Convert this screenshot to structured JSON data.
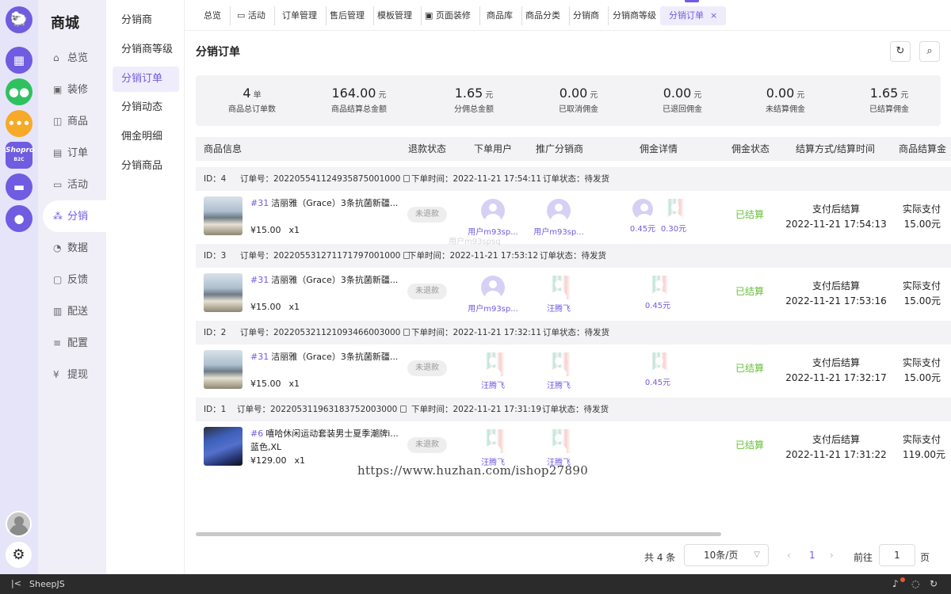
{
  "rail": {
    "apps": [
      {
        "icon": "grid-app-icon",
        "color": "#6f5ce0"
      },
      {
        "icon": "wechat-app-icon",
        "color": "#2fc160"
      },
      {
        "icon": "chat-app-icon",
        "color": "#f7a928"
      },
      {
        "icon": "shopro-app-icon",
        "color": "#6f5ce0",
        "text": "Shopro",
        "sub": "B2C"
      },
      {
        "icon": "folder-app-icon",
        "color": "#6f5ce0"
      },
      {
        "icon": "user-app-icon",
        "color": "#6f5ce0"
      }
    ]
  },
  "sidebar": {
    "title": "商城",
    "items": [
      {
        "label": "总览",
        "icon": "home-icon"
      },
      {
        "label": "装修",
        "icon": "shop-icon"
      },
      {
        "label": "商品",
        "icon": "bag-icon"
      },
      {
        "label": "订单",
        "icon": "order-icon"
      },
      {
        "label": "活动",
        "icon": "activity-icon"
      },
      {
        "label": "分销",
        "icon": "network-icon",
        "active": true
      },
      {
        "label": "数据",
        "icon": "pie-icon"
      },
      {
        "label": "反馈",
        "icon": "feedback-icon"
      },
      {
        "label": "配送",
        "icon": "delivery-icon"
      },
      {
        "label": "配置",
        "icon": "sliders-icon"
      },
      {
        "label": "提现",
        "icon": "yen-icon"
      }
    ]
  },
  "submenu": {
    "items": [
      "分销商",
      "分销商等级",
      "分销订单",
      "分销动态",
      "佣金明细",
      "分销商品"
    ],
    "active": "分销订单"
  },
  "tabs": [
    {
      "label": "总览"
    },
    {
      "label": "活动",
      "icon": "monitor-icon"
    },
    {
      "label": "订单管理"
    },
    {
      "label": "售后管理"
    },
    {
      "label": "模板管理"
    },
    {
      "label": "页面装修",
      "icon": "shop-icon"
    },
    {
      "label": "商品库"
    },
    {
      "label": "商品分类"
    },
    {
      "label": "分销商"
    },
    {
      "label": "分销商等级"
    },
    {
      "label": "分销订单",
      "active": true,
      "close": "×"
    }
  ],
  "page": {
    "title": "分销订单",
    "refresh_icon": "↻",
    "search_icon": "⌕"
  },
  "stats": [
    {
      "value": "4",
      "unit": "单",
      "label": "商品总订单数"
    },
    {
      "value": "164.00",
      "unit": "元",
      "label": "商品结算总金额"
    },
    {
      "value": "1.65",
      "unit": "元",
      "label": "分佣总金额"
    },
    {
      "value": "0.00",
      "unit": "元",
      "label": "已取消佣金"
    },
    {
      "value": "0.00",
      "unit": "元",
      "label": "已退回佣金"
    },
    {
      "value": "0.00",
      "unit": "元",
      "label": "未结算佣金"
    },
    {
      "value": "1.65",
      "unit": "元",
      "label": "已结算佣金"
    }
  ],
  "table": {
    "columns": [
      "商品信息",
      "退款状态",
      "下单用户",
      "推广分销商",
      "佣金详情",
      "佣金状态",
      "结算方式/结算时间",
      "商品结算金"
    ],
    "orders": [
      {
        "id": "ID：4",
        "order_no": "订单号：2022055411249358750010​00",
        "time": "下单时间：2022-11-21 17:54:11",
        "status": "订单状态：待发货",
        "goods_id": "#31",
        "goods_name": "洁丽雅（Grace）3条抗菌新疆...",
        "sku": "",
        "price": "¥15.00",
        "qty": "x1",
        "refund": "未退款",
        "buyer": "用户m93sp...",
        "promoter": "用户m93sp...",
        "commissions": [
          {
            "amount": "0.45元",
            "avatar": "default"
          },
          {
            "amount": "0.30元",
            "avatar": "figure"
          }
        ],
        "commission_status": "已结算",
        "settle_way": "支付后结算",
        "settle_time": "2022-11-21 17:54:13",
        "real_label": "实际支付",
        "real_amount": "15.00元"
      },
      {
        "id": "ID：3",
        "order_no": "订单号：2022055312711717970010​00",
        "time": "下单时间：2022-11-21 17:53:12",
        "status": "订单状态：待发货",
        "goods_id": "#31",
        "goods_name": "洁丽雅（Grace）3条抗菌新疆...",
        "sku": "",
        "price": "¥15.00",
        "qty": "x1",
        "refund": "未退款",
        "buyer": "用户m93sp...",
        "promoter": "汪腾飞",
        "commissions": [
          {
            "amount": "0.45元",
            "avatar": "figure"
          }
        ],
        "commission_status": "已结算",
        "settle_way": "支付后结算",
        "settle_time": "2022-11-21 17:53:16",
        "real_label": "实际支付",
        "real_amount": "15.00元"
      },
      {
        "id": "ID：2",
        "order_no": "订单号：2022053211210934660030​00",
        "time": "下单时间：2022-11-21 17:32:11",
        "status": "订单状态：待发货",
        "goods_id": "#31",
        "goods_name": "洁丽雅（Grace）3条抗菌新疆...",
        "sku": "",
        "price": "¥15.00",
        "qty": "x1",
        "refund": "未退款",
        "buyer": "汪腾飞",
        "promoter": "汪腾飞",
        "commissions": [
          {
            "amount": "0.45元",
            "avatar": "figure"
          }
        ],
        "commission_status": "已结算",
        "settle_way": "支付后结算",
        "settle_time": "2022-11-21 17:32:17",
        "real_label": "实际支付",
        "real_amount": "15.00元"
      },
      {
        "id": "ID：1",
        "order_no": "订单号：2022053119631837520030​00",
        "time": "下单时间：2022-11-21 17:31:19",
        "status": "订单状态：待发货",
        "goods_id": "#6",
        "goods_name": "嘻哈休闲运动套装男士夏季潮牌i...",
        "sku": "蓝色,XL",
        "price": "¥129.00",
        "qty": "x1",
        "refund": "未退款",
        "buyer": "汪腾飞",
        "promoter": "汪腾飞",
        "commissions": [],
        "commission_status": "已结算",
        "settle_way": "支付后结算",
        "settle_time": "2022-11-21 17:31:22",
        "real_label": "实际支付",
        "real_amount": "119.00元"
      }
    ]
  },
  "pagination": {
    "total": "共 4 条",
    "page_size": "10条/页",
    "current": "1",
    "goto_label": "前往",
    "goto_value": "1",
    "page_unit": "页"
  },
  "watermark": "https://www.huzhan.com/ishop27890",
  "ghost_text": "用户m93spsq",
  "bottombar": {
    "app_name": "SheepJS"
  },
  "colors": {
    "accent": "#6f5ce0",
    "success": "#67c23a"
  }
}
